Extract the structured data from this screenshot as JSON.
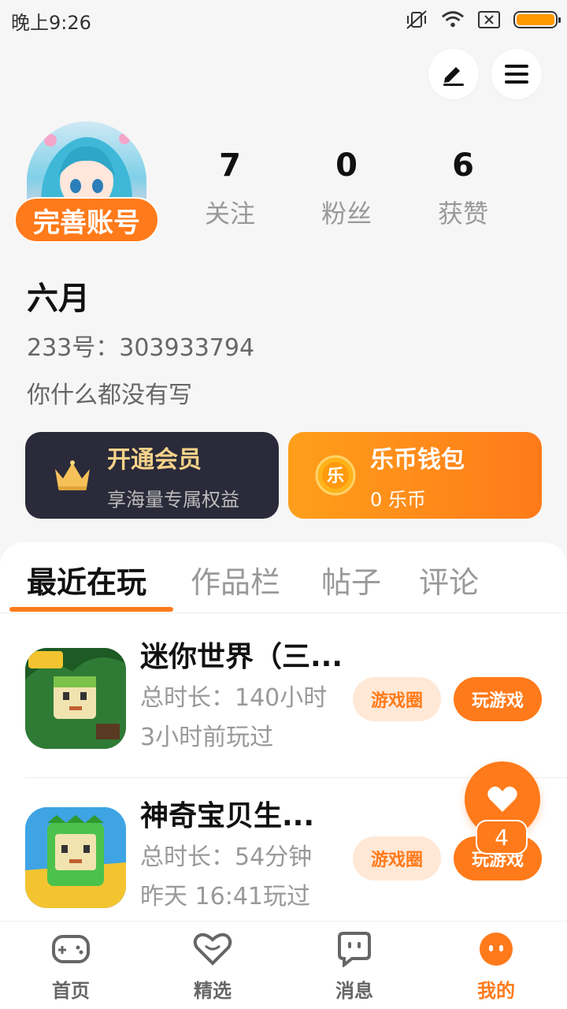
{
  "status_bar": {
    "time": "晚上9:26"
  },
  "profile": {
    "complete_account_label": "完善账号",
    "username": "六月",
    "id_text": "233号：303933794",
    "bio": "你什么都没有写",
    "stats": [
      {
        "value": "7",
        "label": "关注"
      },
      {
        "value": "0",
        "label": "粉丝"
      },
      {
        "value": "6",
        "label": "获赞"
      }
    ]
  },
  "cards": {
    "vip": {
      "title": "开通会员",
      "subtitle": "享海量专属权益"
    },
    "wallet": {
      "title": "乐币钱包",
      "subtitle": "0 乐币",
      "icon_text": "乐"
    }
  },
  "tabs": [
    {
      "label": "最近在玩",
      "active": true
    },
    {
      "label": "作品栏",
      "active": false
    },
    {
      "label": "帖子",
      "active": false
    },
    {
      "label": "评论",
      "active": false
    }
  ],
  "games": [
    {
      "title": "迷你世界（三...",
      "duration": "总时长：140小时",
      "last_played": "3小时前玩过",
      "circle_label": "游戏圈",
      "play_label": "玩游戏"
    },
    {
      "title": "神奇宝贝生...",
      "duration": "总时长：54分钟",
      "last_played": "昨天 16:41玩过",
      "circle_label": "游戏圈",
      "play_label": "玩游戏"
    }
  ],
  "floating_like": {
    "count": "4"
  },
  "bottom_nav": [
    {
      "label": "首页",
      "icon": "gamepad-icon",
      "active": false
    },
    {
      "label": "精选",
      "icon": "heart-chat-icon",
      "active": false
    },
    {
      "label": "消息",
      "icon": "message-icon",
      "active": false
    },
    {
      "label": "我的",
      "icon": "profile-icon",
      "active": true
    }
  ],
  "colors": {
    "accent": "#ff7a1a",
    "vip_bg": "#2a2a3a",
    "vip_text": "#f7d389"
  }
}
